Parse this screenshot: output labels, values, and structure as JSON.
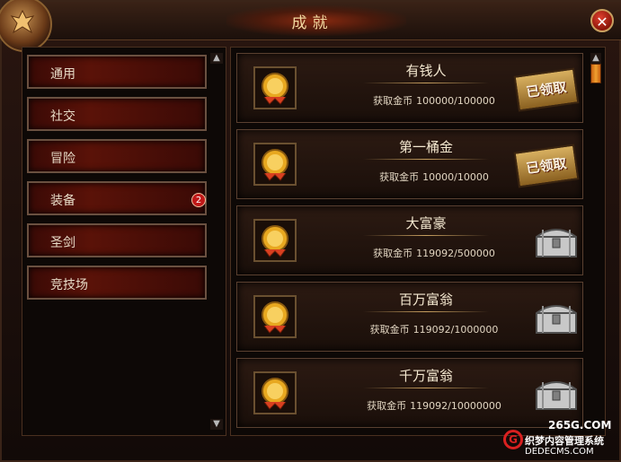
{
  "window": {
    "title": "成就",
    "close_icon": "close-icon"
  },
  "nav": {
    "items": [
      {
        "label": "通用"
      },
      {
        "label": "社交"
      },
      {
        "label": "冒险"
      },
      {
        "label": "装备",
        "badge": "2"
      },
      {
        "label": "圣剑"
      },
      {
        "label": "竞技场"
      }
    ]
  },
  "achievements": [
    {
      "title": "有钱人",
      "progress_label": "获取金币",
      "progress": "100000/100000",
      "status": "已领取"
    },
    {
      "title": "第一桶金",
      "progress_label": "获取金币",
      "progress": "10000/10000",
      "status": "已领取"
    },
    {
      "title": "大富豪",
      "progress_label": "获取金币",
      "progress": "119092/500000",
      "status": "chest"
    },
    {
      "title": "百万富翁",
      "progress_label": "获取金币",
      "progress": "119092/1000000",
      "status": "chest"
    },
    {
      "title": "千万富翁",
      "progress_label": "获取金币",
      "progress": "119092/10000000",
      "status": "chest"
    }
  ],
  "watermark": {
    "site": "265G.COM",
    "cms": "织梦内容管理系统",
    "domain": "DEDECMS.COM",
    "logo_letter": "G"
  }
}
